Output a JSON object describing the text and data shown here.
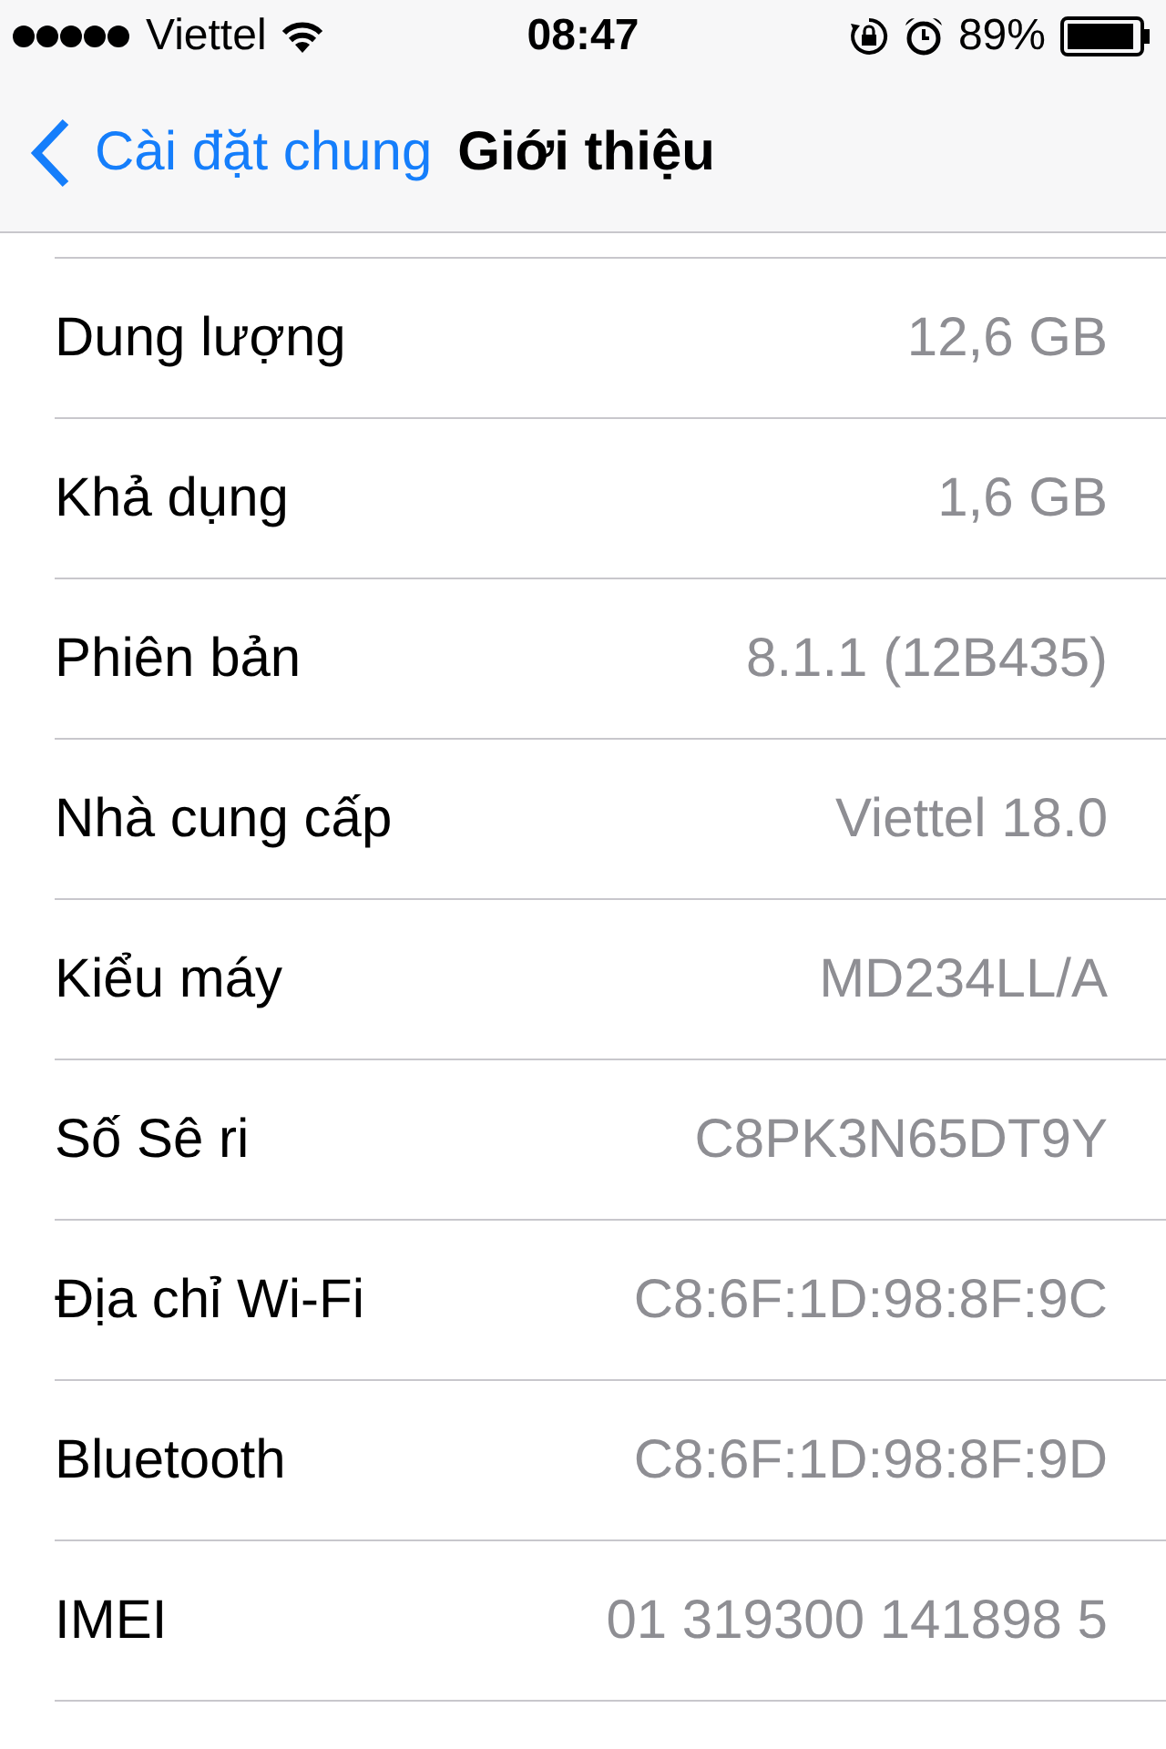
{
  "status_bar": {
    "carrier": "Viettel",
    "time": "08:47",
    "battery": "89%"
  },
  "nav": {
    "back": "Cài đặt chung",
    "title": "Giới thiệu"
  },
  "rows": [
    {
      "label": "Dung lượng",
      "value": "12,6 GB"
    },
    {
      "label": "Khả dụng",
      "value": "1,6 GB"
    },
    {
      "label": "Phiên bản",
      "value": "8.1.1 (12B435)"
    },
    {
      "label": "Nhà cung cấp",
      "value": "Viettel 18.0"
    },
    {
      "label": "Kiểu máy",
      "value": "MD234LL/A"
    },
    {
      "label": "Số Sê ri",
      "value": "C8PK3N65DT9Y"
    },
    {
      "label": "Địa chỉ Wi-Fi",
      "value": "C8:6F:1D:98:8F:9C"
    },
    {
      "label": "Bluetooth",
      "value": "C8:6F:1D:98:8F:9D"
    },
    {
      "label": "IMEI",
      "value": "01 319300 141898 5"
    }
  ]
}
